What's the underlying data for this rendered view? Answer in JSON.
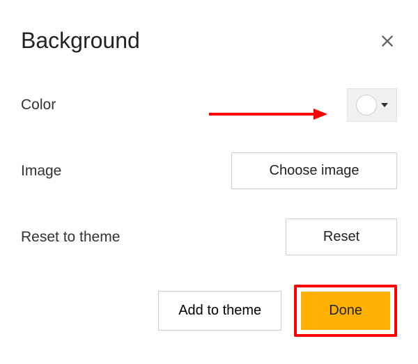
{
  "dialog": {
    "title": "Background",
    "close_icon": "close-icon"
  },
  "rows": {
    "color": {
      "label": "Color",
      "swatch_color": "#ffffff"
    },
    "image": {
      "label": "Image",
      "button_label": "Choose image"
    },
    "reset": {
      "label": "Reset to theme",
      "button_label": "Reset"
    }
  },
  "footer": {
    "add_to_theme_label": "Add to theme",
    "done_label": "Done"
  },
  "annotation": {
    "arrow_color": "#ff0000",
    "highlight_color": "#ff0000"
  }
}
